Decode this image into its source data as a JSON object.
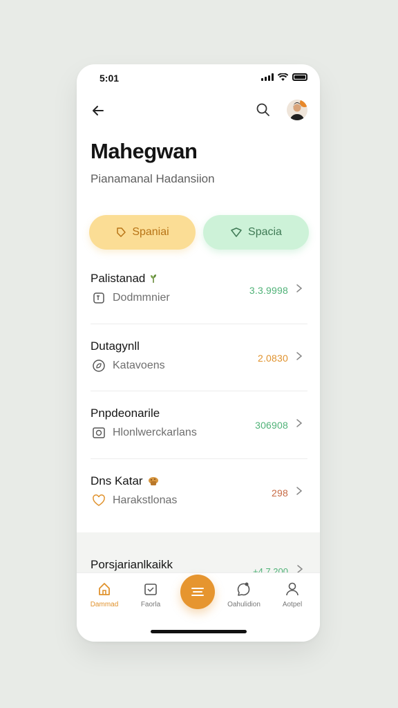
{
  "status": {
    "time": "5:01"
  },
  "header": {
    "title": "Mahegwan",
    "subtitle": "Pianamanal Hadansiion"
  },
  "actions": {
    "primary_label": "Spaniai",
    "secondary_label": "Spacia"
  },
  "list": [
    {
      "title": "Palistanad",
      "subtitle": "Dodmmnier",
      "amount": "3.3.9998",
      "tone": "green"
    },
    {
      "title": "Dutagynll",
      "subtitle": "Katavoens",
      "amount": "2.0830",
      "tone": "orange"
    },
    {
      "title": "Pnpdeonarile",
      "subtitle": "Hlonlwerckarlans",
      "amount": "306908",
      "tone": "green"
    },
    {
      "title": "Dns Katar",
      "subtitle": "Harakstlonas",
      "amount": "298",
      "tone": "red"
    }
  ],
  "band": {
    "title": "Porsjarianlkaikk",
    "amount": "+4.7.200"
  },
  "tabs": [
    {
      "label": "Dammad",
      "icon": "home-icon",
      "active": true
    },
    {
      "label": "Faorla",
      "icon": "calendar-icon",
      "active": false
    },
    {
      "label": "Oahulidion",
      "icon": "chat-icon",
      "active": false
    },
    {
      "label": "Aotpel",
      "icon": "user-icon",
      "active": false
    }
  ],
  "colors": {
    "accent": "#e6952f",
    "green": "#4fb277",
    "yellow_pill": "#fbdd95",
    "green_pill": "#cdf2d8"
  }
}
